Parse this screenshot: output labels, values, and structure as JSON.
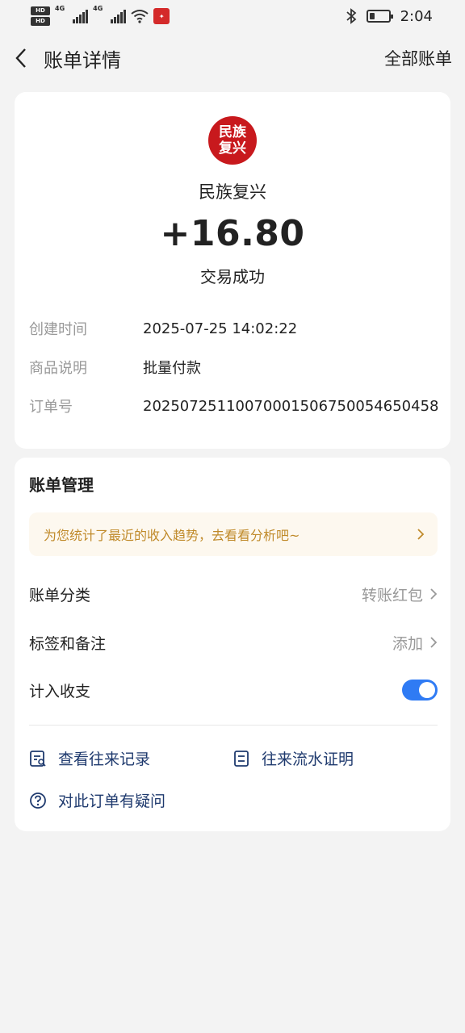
{
  "status_bar": {
    "hd1": "HD",
    "hd2": "HD",
    "net1": "4G",
    "net2": "4G",
    "time": "2:04",
    "battery_level": 0.3,
    "icons": [
      "signal-icon",
      "wifi-icon",
      "bluetooth-icon",
      "battery-icon"
    ]
  },
  "nav": {
    "title": "账单详情",
    "right_action": "全部账单"
  },
  "merchant": {
    "logo_text_line1": "民族",
    "logo_text_line2": "复兴",
    "logo_color": "#c8191d",
    "name": "民族复兴"
  },
  "transaction": {
    "amount": "+16.80",
    "status": "交易成功"
  },
  "details": [
    {
      "label": "创建时间",
      "value": "2025-07-25 14:02:22"
    },
    {
      "label": "商品说明",
      "value": "批量付款"
    },
    {
      "label": "订单号",
      "value": "2025072511007000150675005465045​8"
    }
  ],
  "management": {
    "title": "账单管理",
    "promo_text": "为您统计了最近的收入趋势，去看看分析吧~",
    "category_label": "账单分类",
    "category_value": "转账红包",
    "tags_label": "标签和备注",
    "tags_value": "添加",
    "income_label": "计入收支",
    "income_enabled": true,
    "link_history": "查看往来记录",
    "link_certificate": "往来流水证明",
    "link_question": "对此订单有疑问"
  },
  "colors": {
    "accent": "#2f7bf4",
    "link": "#1f3a6e",
    "promo_text": "#c08a2a",
    "promo_bg": "#fdf8ef"
  }
}
